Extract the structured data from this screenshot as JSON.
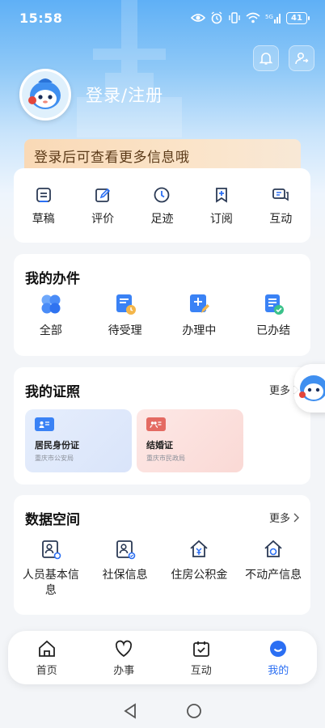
{
  "status_bar": {
    "time": "15:58",
    "battery": "41"
  },
  "header": {
    "login_label": "登录/注册",
    "promo_text": "登录后可查看更多信息哦"
  },
  "quick_actions": [
    {
      "label": "草稿",
      "icon": "draft-icon"
    },
    {
      "label": "评价",
      "icon": "review-icon"
    },
    {
      "label": "足迹",
      "icon": "footprint-clock-icon"
    },
    {
      "label": "订阅",
      "icon": "subscribe-icon"
    },
    {
      "label": "互动",
      "icon": "chat-icon"
    }
  ],
  "my_affairs": {
    "title": "我的办件",
    "items": [
      {
        "label": "全部",
        "icon": "all-icon"
      },
      {
        "label": "待受理",
        "icon": "pending-icon"
      },
      {
        "label": "办理中",
        "icon": "processing-icon"
      },
      {
        "label": "已办结",
        "icon": "completed-icon"
      }
    ]
  },
  "my_licences": {
    "title": "我的证照",
    "more_label": "更多",
    "cards": [
      {
        "name": "居民身份证",
        "org": "重庆市公安局"
      },
      {
        "name": "结婚证",
        "org": "重庆市民政局"
      }
    ]
  },
  "data_space": {
    "title": "数据空间",
    "more_label": "更多",
    "items": [
      {
        "label": "人员基本信息",
        "icon": "person-info-icon"
      },
      {
        "label": "社保信息",
        "icon": "social-security-icon"
      },
      {
        "label": "住房公积金",
        "icon": "housing-fund-icon"
      },
      {
        "label": "不动产信息",
        "icon": "real-estate-icon"
      }
    ]
  },
  "tabbar": [
    {
      "label": "首页",
      "icon": "home-icon",
      "active": false
    },
    {
      "label": "办事",
      "icon": "heart-icon",
      "active": false
    },
    {
      "label": "互动",
      "icon": "calendar-check-icon",
      "active": false
    },
    {
      "label": "我的",
      "icon": "smile-icon",
      "active": true
    }
  ],
  "colors": {
    "primary": "#2b6ff3",
    "hero": "#5fb0f6",
    "promo": "#f9d9b6"
  }
}
